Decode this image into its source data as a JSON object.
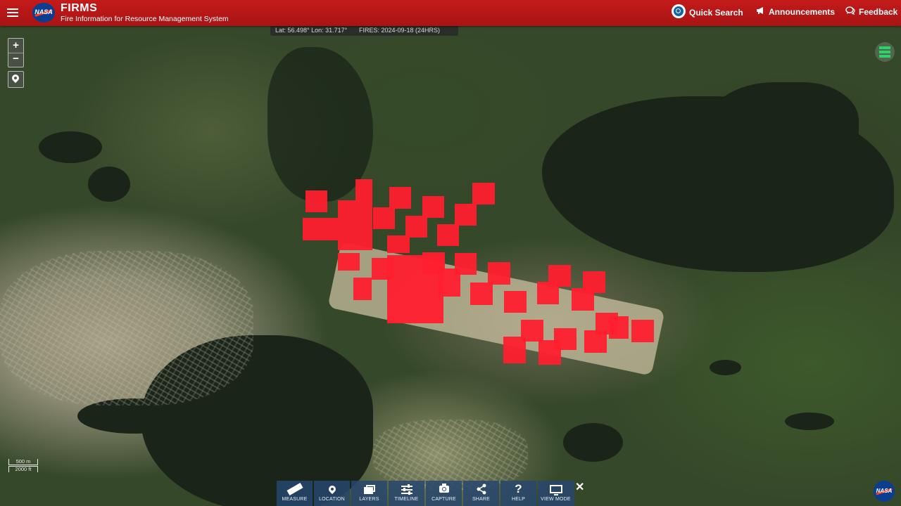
{
  "header": {
    "brand_title": "FIRMS",
    "brand_subtitle": "Fire Information for Resource Management System",
    "logo_text": "NASA",
    "quick_search_label": "Quick Search",
    "announcements_label": "Announcements",
    "feedback_label": "Feedback",
    "background_color": "#b71818"
  },
  "coord_bar": {
    "lat_lon": "Lat: 56.498°  Lon: 31.717°",
    "fires": "FIRES: 2024-09-18 (24HRS)"
  },
  "map_controls": {
    "zoom_in": "+",
    "zoom_out": "−"
  },
  "scale": {
    "metric": "500 m",
    "imperial": "2000 ft"
  },
  "toolbar": {
    "items": [
      {
        "label": "MEASURE",
        "icon": "ruler-icon"
      },
      {
        "label": "LOCATION",
        "icon": "location-pin-icon"
      },
      {
        "label": "LAYERS",
        "icon": "layers-icon"
      },
      {
        "label": "TIMELINE",
        "icon": "sliders-icon"
      },
      {
        "label": "CAPTURE",
        "icon": "camera-icon"
      },
      {
        "label": "SHARE",
        "icon": "share-icon"
      },
      {
        "label": "HELP",
        "icon": "help-icon"
      },
      {
        "label": "VIEW MODE",
        "icon": "monitor-icon"
      }
    ],
    "close": "✕"
  },
  "fire_color": "#ff1f2e"
}
